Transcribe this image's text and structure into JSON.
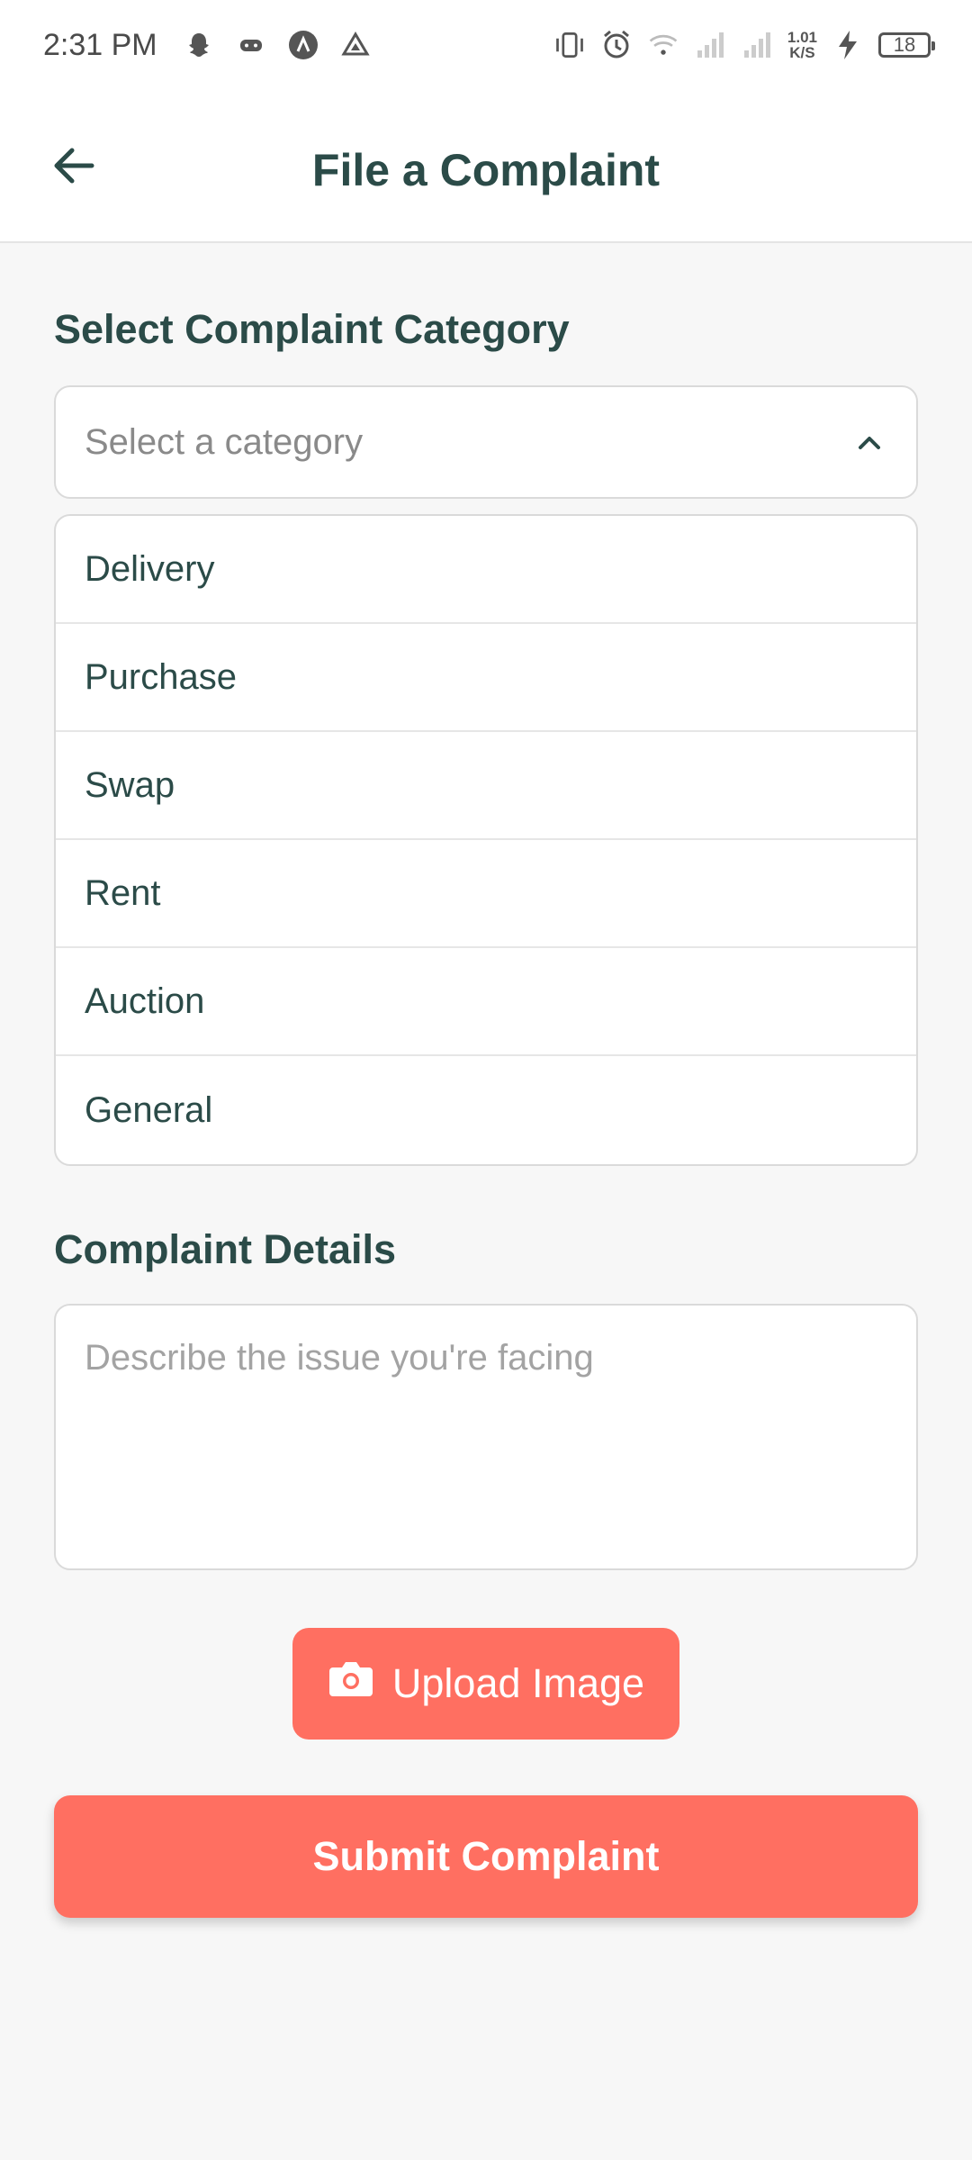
{
  "status_bar": {
    "time": "2:31 PM",
    "net_speed_value": "1.01",
    "net_speed_unit": "K/S",
    "battery": "18",
    "left_icons": [
      "snapchat-icon",
      "game-icon",
      "app-a-icon",
      "drive-icon"
    ],
    "right_icons": [
      "vibrate-icon",
      "alarm-icon",
      "wifi-icon",
      "signal-icon",
      "signal-icon",
      "charging-icon"
    ]
  },
  "header": {
    "title": "File a Complaint",
    "back_icon": "arrow-left-icon"
  },
  "category": {
    "label": "Select Complaint Category",
    "placeholder": "Select a category",
    "options": [
      "Delivery",
      "Purchase",
      "Swap",
      "Rent",
      "Auction",
      "General"
    ]
  },
  "details": {
    "label": "Complaint Details",
    "placeholder": "Describe the issue you're facing"
  },
  "actions": {
    "upload_label": "Upload Image",
    "upload_icon": "camera-icon",
    "submit_label": "Submit Complaint"
  },
  "colors": {
    "accent": "#FF6F61",
    "text_primary": "#2B4B48",
    "background": "#F7F7F7"
  }
}
